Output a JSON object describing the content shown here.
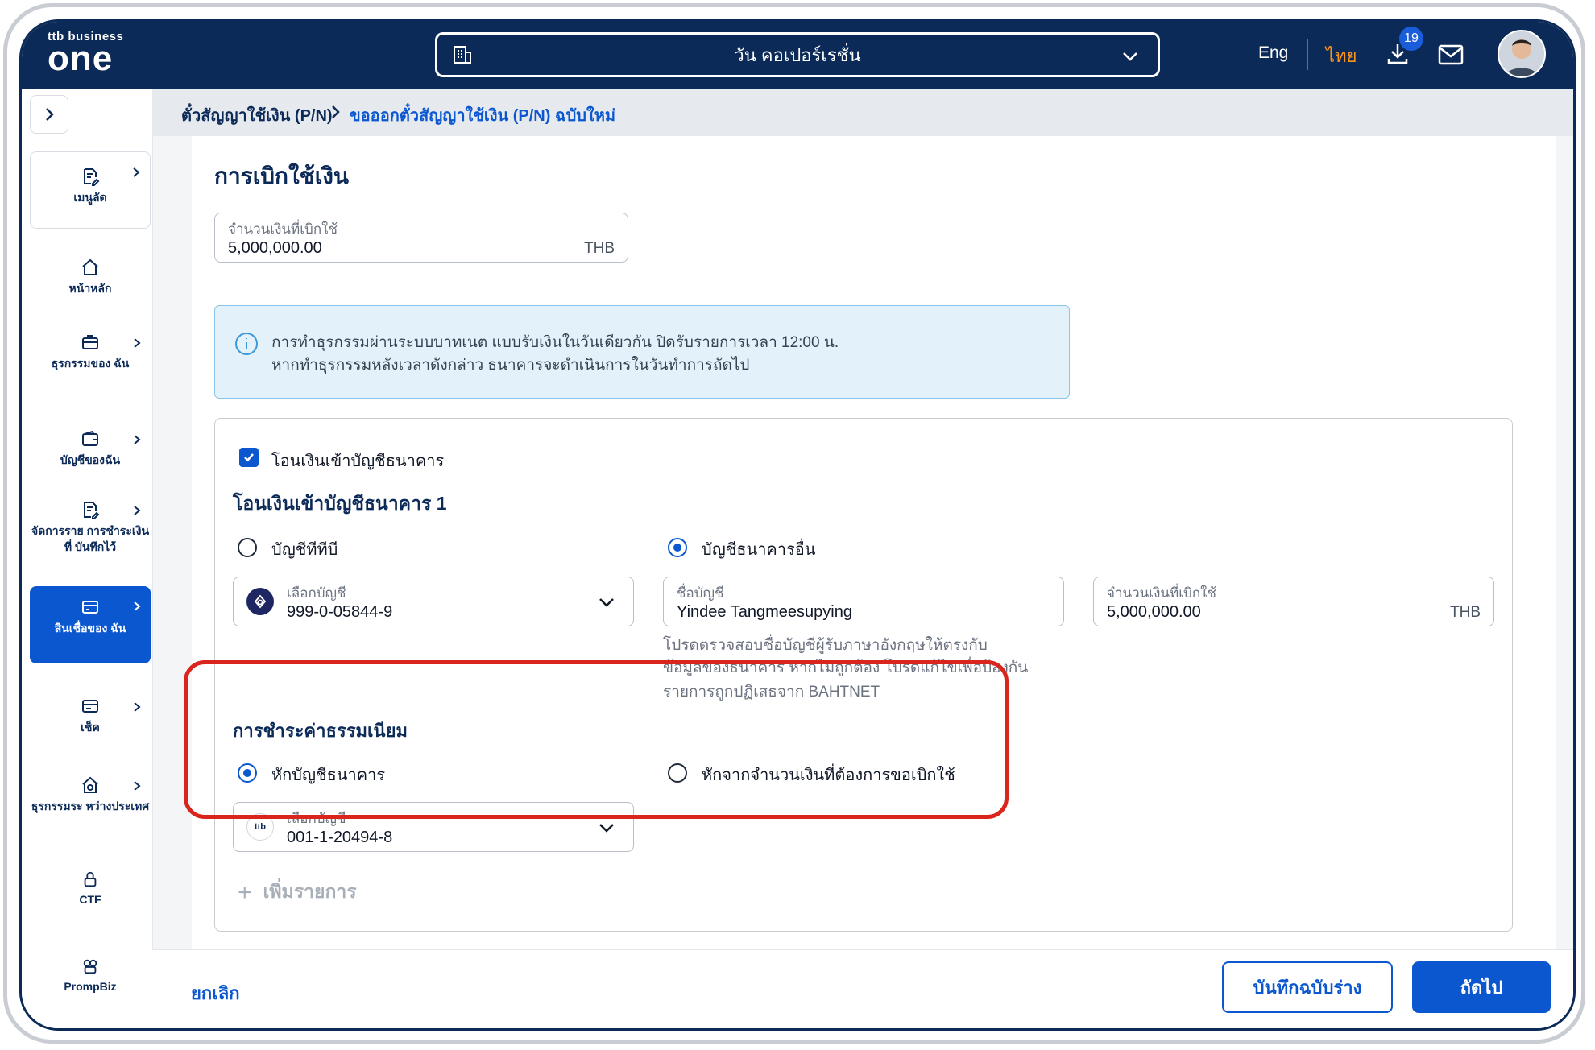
{
  "header": {
    "logo_top": "ttb business",
    "logo_main": "one",
    "company": "วัน คอเปอร์เรชั่น",
    "lang_en": "Eng",
    "lang_th": "ไทย",
    "download_badge": "19"
  },
  "sidebar": {
    "items": [
      {
        "label": "เมนูลัด"
      },
      {
        "label": "หน้าหลัก"
      },
      {
        "label": "ธุรกรรมของ ฉัน"
      },
      {
        "label": "บัญชีของฉัน"
      },
      {
        "label": "จัดการราย การชำระเงินที่ บันทึกไว้"
      },
      {
        "label": "สินเชื่อของ ฉัน"
      },
      {
        "label": "เช็ค"
      },
      {
        "label": "ธุรกรรมระ หว่างประเทศ"
      },
      {
        "label": "CTF"
      },
      {
        "label": "PrompBiz"
      }
    ]
  },
  "breadcrumb": {
    "parent": "ตั๋วสัญญาใช้เงิน (P/N)",
    "current": "ขอออกตั๋วสัญญาใช้เงิน (P/N) ฉบับใหม่"
  },
  "main": {
    "title": "การเบิกใช้เงิน",
    "amount": {
      "label": "จำนวนเงินที่เบิกใช้",
      "value": "5,000,000.00",
      "unit": "THB"
    },
    "info": {
      "line1": "การทำธุรกรรมผ่านระบบบาทเนต แบบรับเงินในวันเดียวกัน ปิดรับรายการเวลา 12:00 น.",
      "line2": "หากทำธุรกรรมหลังเวลาดังกล่าว ธนาคารจะดำเนินการในวันทำการถัดไป"
    },
    "transfer": {
      "checkbox_label": "โอนเงินเข้าบัญชีธนาคาร",
      "section_title": "โอนเงินเข้าบัญชีธนาคาร 1",
      "radio_ttb": "บัญชีทีทีบี",
      "radio_other": "บัญชีธนาคารอื่น",
      "account": {
        "label": "เลือกบัญชี",
        "value": "999-0-05844-9"
      },
      "account_name": {
        "label": "ชื่อบัญชี",
        "value": "Yindee Tangmeesupying"
      },
      "amount": {
        "label": "จำนวนเงินที่เบิกใช้",
        "value": "5,000,000.00",
        "unit": "THB"
      },
      "hint_line1": "โปรดตรวจสอบชื่อบัญชีผู้รับภาษาอังกฤษให้ตรงกับ",
      "hint_line2": "ข้อมูลของธนาคาร หากไม่ถูกต้อง โปรดแก้ไขเพื่อป้องกัน",
      "hint_line3": "รายการถูกปฏิเสธจาก BAHTNET"
    },
    "fee": {
      "section_title": "การชำระค่าธรรมเนียม",
      "radio_deduct_account": "หักบัญชีธนาคาร",
      "radio_deduct_amount": "หักจากจำนวนเงินที่ต้องการขอเบิกใช้",
      "account": {
        "label": "เลือกบัญชี",
        "value": "001-1-20494-8"
      },
      "bank_logo": "ttb"
    },
    "add_item": "เพิ่มรายการ"
  },
  "footer": {
    "cancel": "ยกเลิก",
    "save_draft": "บันทึกฉบับร่าง",
    "next": "ถัดไป"
  },
  "colors": {
    "navy": "#0c2a57",
    "primary": "#0b57d0",
    "accent_orange": "#f7941d",
    "highlight_red": "#d9251d"
  }
}
